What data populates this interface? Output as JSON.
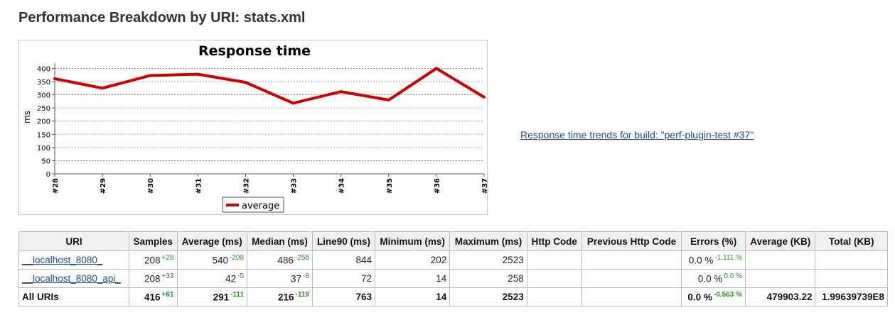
{
  "page": {
    "title": "Performance Breakdown by URI: stats.xml",
    "trend_link": " Response time trends for build: \"perf-plugin-test #37\""
  },
  "chart_data": {
    "type": "line",
    "title": "Response time",
    "ylabel": "ms",
    "xlabel": "",
    "categories": [
      "#28",
      "#29",
      "#30",
      "#31",
      "#32",
      "#33",
      "#34",
      "#35",
      "#36",
      "#37"
    ],
    "series": [
      {
        "name": "average",
        "values": [
          361,
          325,
          373,
          378,
          347,
          268,
          312,
          280,
          400,
          291
        ],
        "color": "#cc0000"
      }
    ],
    "ylim": [
      0,
      420
    ],
    "yticks": [
      0,
      50,
      100,
      150,
      200,
      250,
      300,
      350,
      400
    ],
    "grid": true,
    "legend": "bottom"
  },
  "table": {
    "headers": [
      "URI",
      "Samples",
      "Average (ms)",
      "Median (ms)",
      "Line90 (ms)",
      "Minimum (ms)",
      "Maximum (ms)",
      "Http Code",
      "Previous Http Code",
      "Errors (%)",
      "Average (KB)",
      "Total (KB)"
    ],
    "rows": [
      {
        "uri": "__localhost_8080_",
        "samples": "208",
        "samples_diff": "+28",
        "average": "540",
        "average_diff": "-208",
        "median": "486",
        "median_diff": "-255",
        "line90": "844",
        "minimum": "202",
        "maximum": "2523",
        "http_code": "",
        "prev_http_code": "",
        "errors": "0.0 %",
        "errors_diff": "-1.111 %",
        "avg_kb": "",
        "total_kb": ""
      },
      {
        "uri": "__localhost_8080_api_",
        "samples": "208",
        "samples_diff": "+33",
        "average": "42",
        "average_diff": "-5",
        "median": "37",
        "median_diff": "-8",
        "line90": "72",
        "minimum": "14",
        "maximum": "258",
        "http_code": "",
        "prev_http_code": "",
        "errors": "0.0 %",
        "errors_diff": "0.0 %",
        "avg_kb": "",
        "total_kb": ""
      }
    ],
    "total": {
      "uri": "All URIs",
      "samples": "416",
      "samples_diff": "+61",
      "average": "291",
      "average_diff": "-111",
      "median": "216",
      "median_diff": "-119",
      "line90": "763",
      "minimum": "14",
      "maximum": "2523",
      "http_code": "",
      "prev_http_code": "",
      "errors": "0.0 %",
      "errors_diff": "-0.563 %",
      "avg_kb": "479903.22",
      "total_kb": "1.99639739E8"
    }
  }
}
